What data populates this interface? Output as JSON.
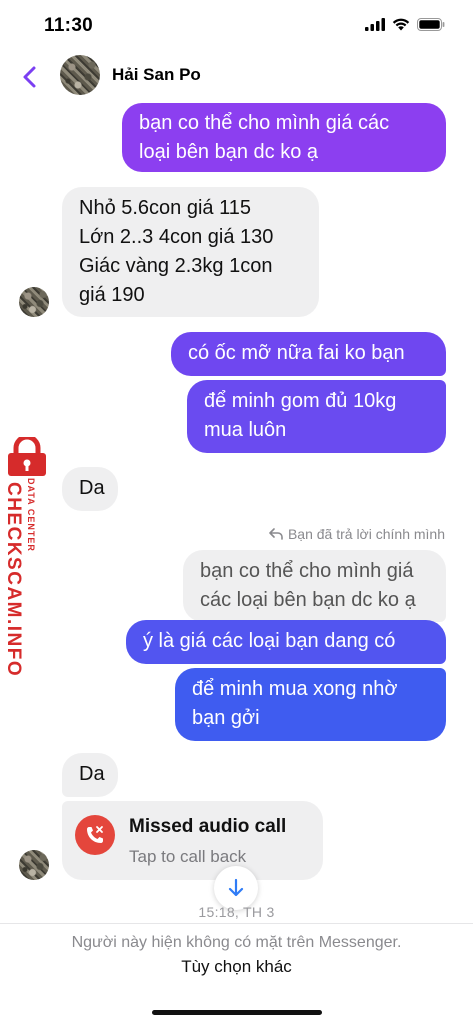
{
  "status_bar": {
    "time": "11:30"
  },
  "header": {
    "contact_name": "Hải San Po"
  },
  "messages": {
    "m1": {
      "lines": [
        "bạn co thể cho mình giá các",
        "loại bên bạn dc ko ạ"
      ]
    },
    "m2": {
      "lines": [
        "Nhỏ 5.6con giá 115",
        "Lớn 2..3 4con giá 130",
        "Giác vàng 2.3kg 1con",
        "giá 190"
      ]
    },
    "m3": {
      "lines": [
        "có ốc mỡ nữa fai ko bạn"
      ]
    },
    "m4": {
      "lines": [
        "để minh gom đủ 10kg",
        "mua luôn"
      ]
    },
    "m5": {
      "lines": [
        "Da"
      ]
    },
    "reply_note": "Bạn đã trả lời chính mình",
    "replied": {
      "lines": [
        "bạn co thể cho mình giá",
        "các loại bên bạn dc ko ạ"
      ]
    },
    "m6": {
      "lines": [
        "ý là giá các loại bạn dang có"
      ]
    },
    "m7": {
      "lines": [
        "để minh mua xong nhờ",
        "bạn gởi"
      ]
    },
    "m8": {
      "lines": [
        "Da"
      ]
    }
  },
  "call_card": {
    "title": "Missed audio call",
    "subtitle": "Tap to call back"
  },
  "timestamp": "15:18, TH 3",
  "footer": {
    "notice": "Người này hiện không có mặt trên Messenger.",
    "options": "Tùy chọn khác"
  },
  "watermark": {
    "main": "CHECKSCAM.INFO",
    "sub": "DATA CENTER"
  },
  "colors": {
    "outgoing_top": "#8c3ff0",
    "outgoing_mid": "#6a4bf0",
    "outgoing_bottom": "#3f5cf0",
    "incoming": "#efeff0",
    "accent": "#7b3ff2",
    "missed_call": "#e4463c"
  },
  "icons": [
    "signal-icon",
    "wifi-icon",
    "battery-icon",
    "back-arrow-icon",
    "reply-arrow-icon",
    "missed-call-icon",
    "arrow-down-icon",
    "lock-icon"
  ]
}
